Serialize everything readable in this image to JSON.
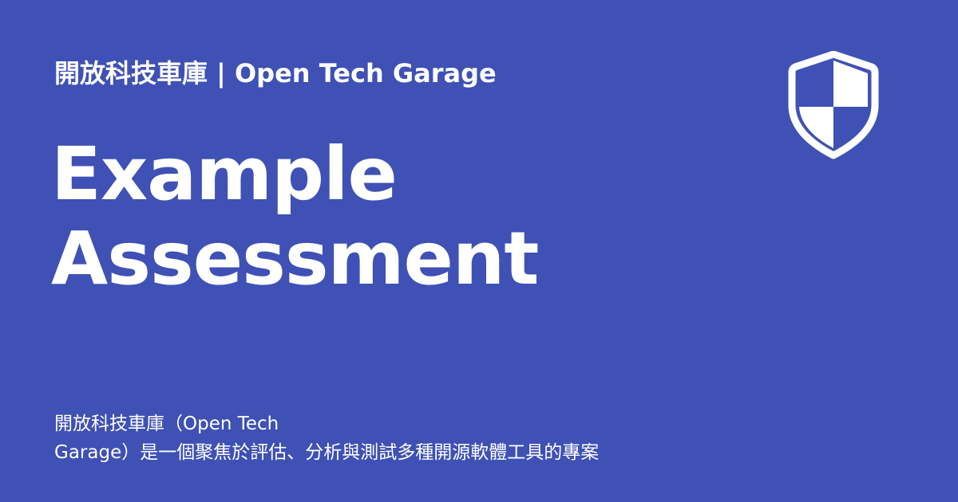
{
  "brand": {
    "text": "開放科技車庫 | Open Tech Garage"
  },
  "title": {
    "line1": "Example",
    "line2": "Assessment"
  },
  "description": {
    "line1": "開放科技車庫（Open Tech",
    "line2": "Garage）是一個聚焦於評估、分析與測試多種開源軟體工具的專案"
  },
  "icons": {
    "shield": "shield-icon"
  },
  "colors": {
    "background": "#3f51b5",
    "foreground": "#ffffff"
  }
}
